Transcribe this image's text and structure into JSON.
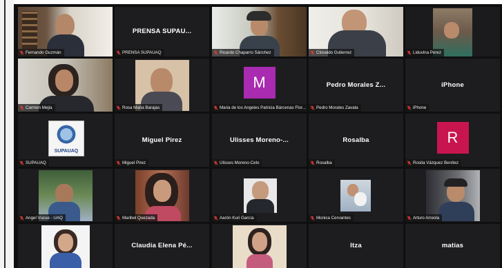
{
  "meeting": {
    "tiles": [
      {
        "name": "Fernando Guzmán",
        "display": ""
      },
      {
        "name": "PRENSA SUPAUAQ",
        "display": "PRENSA  SUPAU..."
      },
      {
        "name": "Ricardo Chaparro Sánchez",
        "display": ""
      },
      {
        "name": "Clovaldo Gutierrez",
        "display": ""
      },
      {
        "name": "Liduvina Perez",
        "display": ""
      },
      {
        "name": "Carmen Mejia",
        "display": ""
      },
      {
        "name": "Rosa Maria Barajas",
        "display": ""
      },
      {
        "name": "Maria de los Angeles Patricia Bárcenas Flor...",
        "display": "",
        "avatar": "M"
      },
      {
        "name": "Pedro Morales Zavala",
        "display": "Pedro Morales Z..."
      },
      {
        "name": "iPhone",
        "display": "iPhone"
      },
      {
        "name": "SUPAUAQ",
        "display": "",
        "logo": "SUPAUAQ"
      },
      {
        "name": "Miguel Pirez",
        "display": "Miguel Pirez"
      },
      {
        "name": "Ulisses Moreno-Celo",
        "display": "Ulisses  Moreno-..."
      },
      {
        "name": "Rosalba",
        "display": "Rosalba"
      },
      {
        "name": "Rosita Vázquez Benítez",
        "display": "",
        "avatar": "R"
      },
      {
        "name": "Angel Vucue - UAQ",
        "display": ""
      },
      {
        "name": "Maribel Quezada",
        "display": ""
      },
      {
        "name": "Aarón Kuri García",
        "display": ""
      },
      {
        "name": "Monica Cervantes",
        "display": ""
      },
      {
        "name": "Arturo Arreola",
        "display": ""
      },
      {
        "name": "",
        "display": ""
      },
      {
        "name": "",
        "display": "Claudia Elena Pé..."
      },
      {
        "name": "",
        "display": ""
      },
      {
        "name": "",
        "display": "Itza"
      },
      {
        "name": "",
        "display": "matias"
      }
    ]
  },
  "colors": {
    "avatar_m": "#a82bb0",
    "avatar_r": "#c8154f",
    "active_speaker": "#4cd964",
    "muted_icon": "#e23b3b"
  }
}
